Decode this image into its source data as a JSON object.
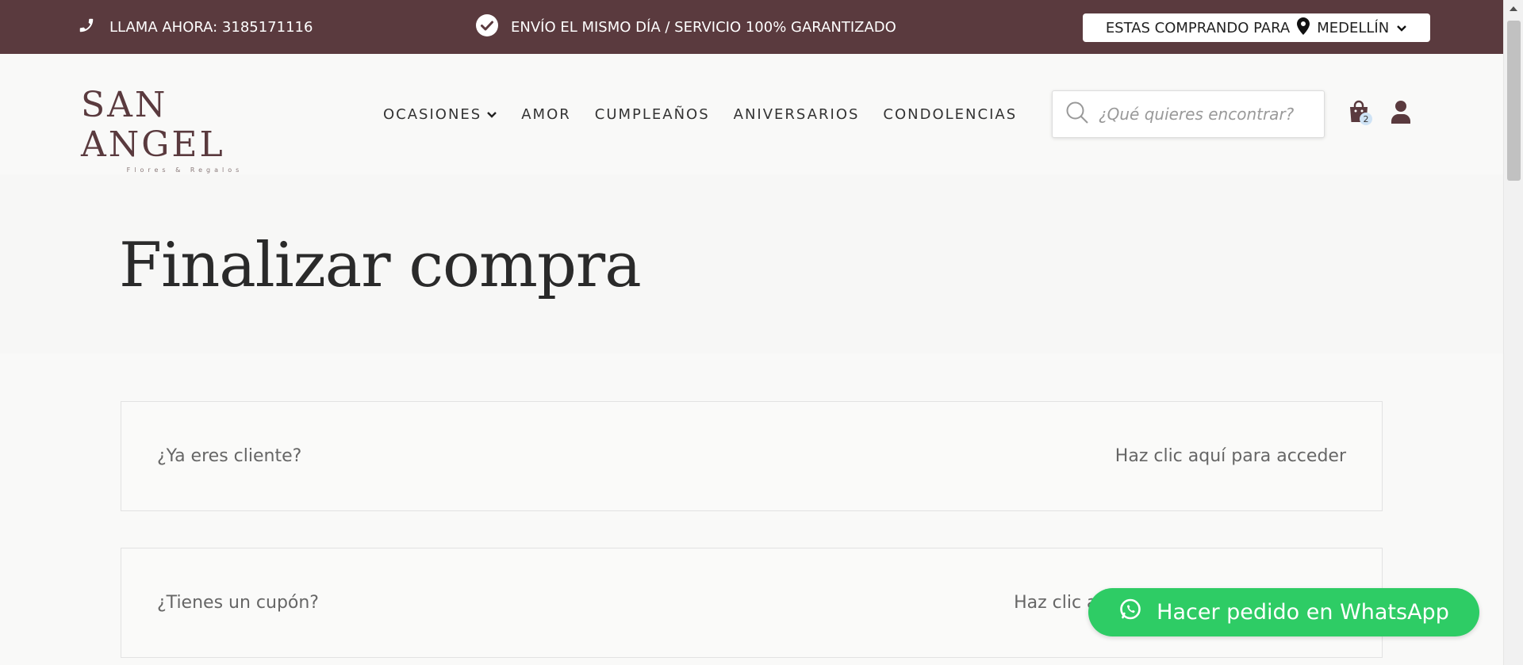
{
  "topbar": {
    "call": "LLAMA AHORA: 3185171116",
    "shipping": "ENVÍO EL MISMO DÍA / SERVICIO 100% GARANTIZADO",
    "buying_for": "ESTAS COMPRANDO PARA",
    "city": "MEDELLÍN",
    "background": "#5a3a3e"
  },
  "header": {
    "logo": {
      "main": "SAN ANGEL",
      "sub": "Flores & Regalos"
    },
    "nav": [
      "OCASIONES",
      "AMOR",
      "CUMPLEAÑOS",
      "ANIVERSARIOS",
      "CONDOLENCIAS"
    ],
    "search_placeholder": "¿Qué quieres encontrar?",
    "cart_count": "2"
  },
  "hero": {
    "title": "Finalizar compra"
  },
  "notices": [
    {
      "question": "¿Ya eres cliente?",
      "link": "Haz clic aquí para acceder"
    },
    {
      "question": "¿Tienes un cupón?",
      "link": "Haz clic aquí para introducir tu código"
    }
  ],
  "whatsapp": {
    "label": "Hacer pedido en WhatsApp",
    "color": "#2ecc65"
  },
  "icons": [
    "phone-icon",
    "check-circle-icon",
    "map-pin-icon",
    "chevron-down-icon",
    "search-icon",
    "shopping-bag-icon",
    "user-icon",
    "whatsapp-icon"
  ]
}
